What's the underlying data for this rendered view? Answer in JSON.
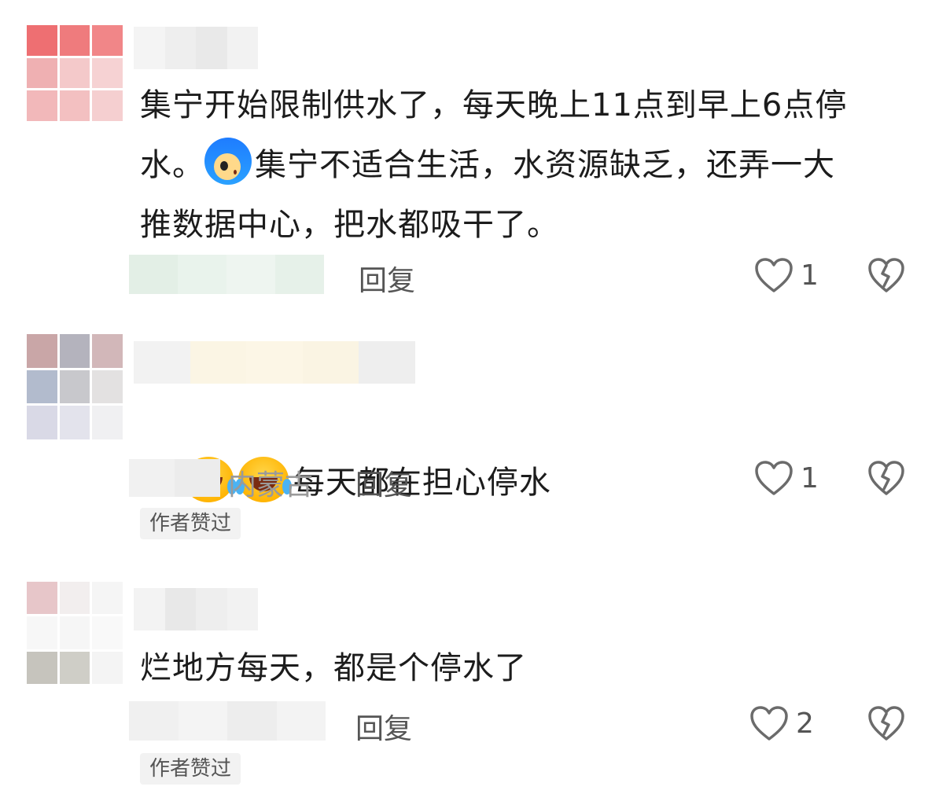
{
  "comments": [
    {
      "text": "集宁开始限制供水了，每天晚上11点到早上6点停\n水。",
      "text_after_emoji": "集宁不适合生活，水资源缺乏，还弄一大\n推数据中心，把水都吸干了。",
      "emoji": "blue-hair-face-icon",
      "location": "",
      "reply_label": "回复",
      "likes": "1",
      "badge": ""
    },
    {
      "text": "每天都在担心停水",
      "emoji": "laughing-tears-icon",
      "location": "内蒙古",
      "reply_label": "回复",
      "likes": "1",
      "badge": "作者赞过"
    },
    {
      "text": "烂地方每天，都是个停水了",
      "location": "",
      "reply_label": "回复",
      "likes": "2",
      "badge": "作者赞过"
    }
  ],
  "colors": {
    "text": "#1c1c1c",
    "secondary": "#555555",
    "location": "#9a9a9a",
    "badge_bg": "#f2f2f2",
    "icon_stroke": "#6b6b6b"
  },
  "icons": {
    "like": "heart-outline-icon",
    "dislike": "broken-heart-icon"
  }
}
